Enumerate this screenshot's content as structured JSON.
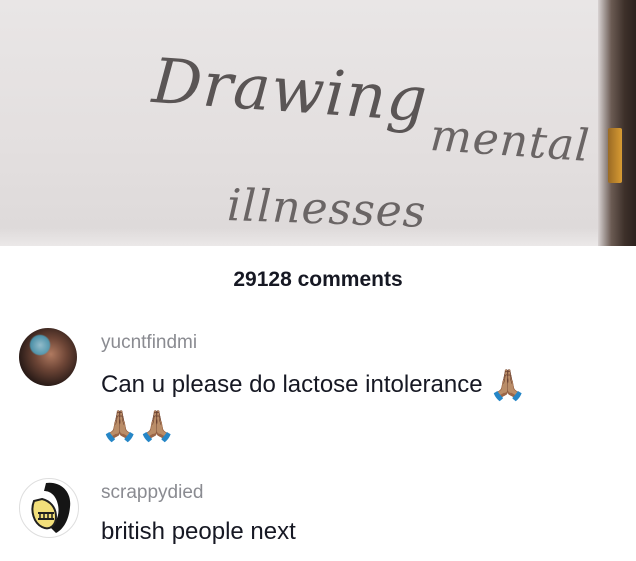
{
  "video": {
    "handwriting_line1": "Drawing",
    "handwriting_line2": "mental",
    "handwriting_line3": "illnesses"
  },
  "comments_panel": {
    "header": "29128 comments",
    "comments": [
      {
        "username": "yucntfindmi",
        "text": "Can u please do lactose intolerance",
        "emoji_line1": "🙏🏽",
        "emoji_line2": "🙏🏽🙏🏽"
      },
      {
        "username": "scrappydied",
        "text": "british people next"
      }
    ]
  }
}
